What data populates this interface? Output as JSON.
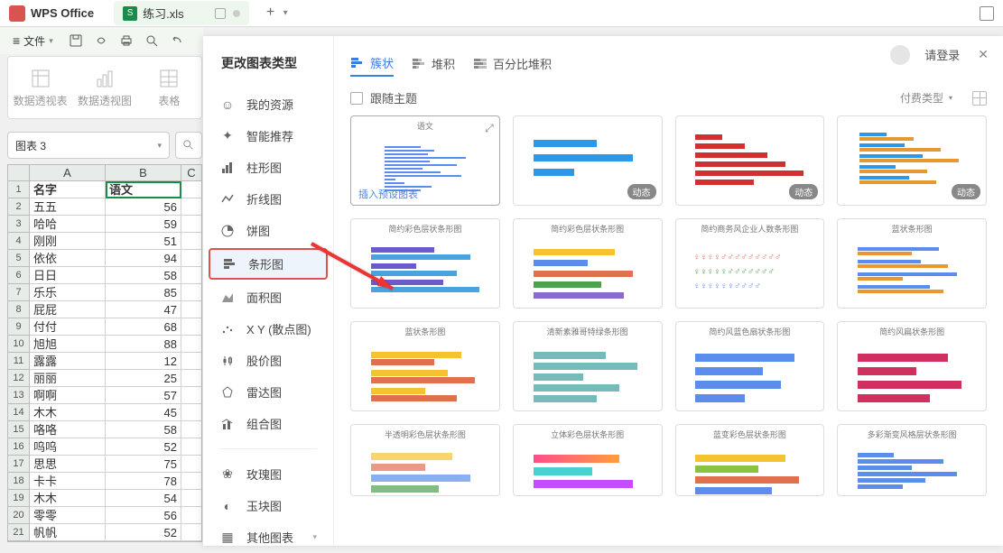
{
  "titlebar": {
    "app": "WPS Office",
    "file": "练习.xls"
  },
  "toolbar": {
    "file": "文件"
  },
  "ribbon": {
    "pivot_table": "数据透视表",
    "pivot_chart": "数据透视图",
    "table": "表格"
  },
  "namebox": {
    "value": "图表 3"
  },
  "grid": {
    "cols": [
      "A",
      "B",
      "C"
    ],
    "rows": [
      {
        "n": 1,
        "a": "名字",
        "b": "语文"
      },
      {
        "n": 2,
        "a": "五五",
        "b": "56"
      },
      {
        "n": 3,
        "a": "哈哈",
        "b": "59"
      },
      {
        "n": 4,
        "a": "刚刚",
        "b": "51"
      },
      {
        "n": 5,
        "a": "依依",
        "b": "94"
      },
      {
        "n": 6,
        "a": "日日",
        "b": "58"
      },
      {
        "n": 7,
        "a": "乐乐",
        "b": "85"
      },
      {
        "n": 8,
        "a": "屁屁",
        "b": "47"
      },
      {
        "n": 9,
        "a": "付付",
        "b": "68"
      },
      {
        "n": 10,
        "a": "旭旭",
        "b": "88"
      },
      {
        "n": 11,
        "a": "露露",
        "b": "12"
      },
      {
        "n": 12,
        "a": "丽丽",
        "b": "25"
      },
      {
        "n": 13,
        "a": "啊啊",
        "b": "57"
      },
      {
        "n": 14,
        "a": "木木",
        "b": "45"
      },
      {
        "n": 15,
        "a": "咯咯",
        "b": "58"
      },
      {
        "n": 16,
        "a": "呜呜",
        "b": "52"
      },
      {
        "n": 17,
        "a": "思思",
        "b": "75"
      },
      {
        "n": 18,
        "a": "卡卡",
        "b": "78"
      },
      {
        "n": 19,
        "a": "木木",
        "b": "54"
      },
      {
        "n": 20,
        "a": "零零",
        "b": "56"
      },
      {
        "n": 21,
        "a": "帆帆",
        "b": "52"
      }
    ]
  },
  "dialog": {
    "title": "更改图表类型",
    "left": {
      "my_res": "我的资源",
      "smart": "智能推荐",
      "bar": "柱形图",
      "line": "折线图",
      "pie": "饼图",
      "hbar": "条形图",
      "area": "面积图",
      "xy": "X Y (散点图)",
      "stock": "股价图",
      "radar": "雷达图",
      "combo": "组合图",
      "rose": "玫瑰图",
      "jade": "玉块图",
      "other": "其他图表"
    },
    "login": "请登录",
    "subtype": {
      "cluster": "簇状",
      "stacked": "堆积",
      "pstacked": "百分比堆积"
    },
    "follow_theme": "跟随主题",
    "paytype": "付费类型",
    "thumbs": {
      "t1_cap": "插入预设图表",
      "dyn": "动态",
      "t5": "简约彩色层状条形图",
      "t6": "简约彩色层状条形图",
      "t7": "简约商务风企业人数条形图",
      "t8": "蓝状条形图",
      "t9": "蓝状条形图",
      "t10": "清新素雅哥特绿条形图",
      "t11": "简约风蓝色扇状条形图",
      "t12": "简约风扁状条形图",
      "t13": "半透明彩色层状条形图",
      "t14": "立体彩色层状条形图",
      "t15": "蓝变彩色层状条形图",
      "t16": "多彩渐变风格层状条形图"
    }
  },
  "colors": {
    "accent": "#1a8c4a",
    "link": "#3a7de0",
    "highlight": "#d9534f"
  },
  "chart_data": {
    "type": "bar",
    "categories": [
      "五五",
      "哈哈",
      "刚刚",
      "依依",
      "日日",
      "乐乐",
      "屁屁",
      "付付",
      "旭旭",
      "露露",
      "丽丽",
      "啊啊",
      "木木",
      "咯咯",
      "呜呜",
      "思思",
      "卡卡",
      "木木",
      "零零",
      "帆帆"
    ],
    "values": [
      56,
      59,
      51,
      94,
      58,
      85,
      47,
      68,
      88,
      12,
      25,
      57,
      45,
      58,
      52,
      75,
      78,
      54,
      56,
      52
    ],
    "title": "语文",
    "xlabel": "",
    "ylabel": "",
    "ylim": [
      0,
      100
    ]
  }
}
